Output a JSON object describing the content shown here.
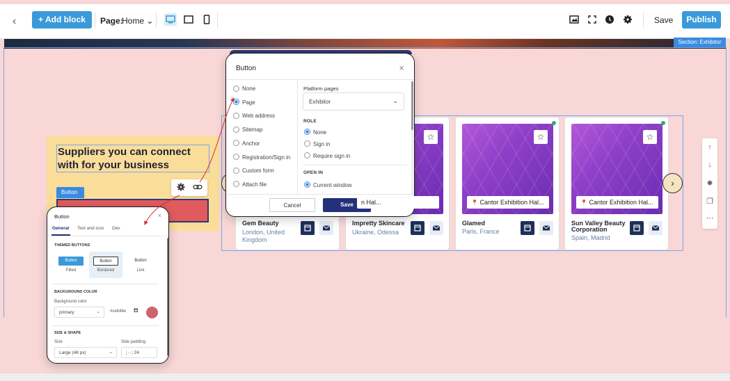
{
  "toolbar": {
    "back": "‹",
    "add_block": "+ Add block",
    "page_label": "Page:",
    "page_value": "Home ⌄",
    "save": "Save",
    "publish": "Publish"
  },
  "canvas": {
    "section_tag": "Section: Exhibitor",
    "heading": "Suppliers you can connect with for your business",
    "button_tag": "Button"
  },
  "cards": [
    {
      "name": "Gem Beauty",
      "sub": "London, United Kingdom",
      "location": ""
    },
    {
      "name": "Impretty Skincare",
      "sub": "Ukraine, Odessa",
      "location": "n Hal..."
    },
    {
      "name": "Glamed",
      "sub": "Paris, France",
      "location": "Cantor Exhibition Hal..."
    },
    {
      "name": "Sun Valley Beauty Corporation",
      "sub": "Spain, Madrid",
      "location": "Cantor Exhibition Hal..."
    }
  ],
  "modal": {
    "title": "Button",
    "close": "×",
    "link_options": [
      "None",
      "Page",
      "Web address",
      "Sitemap",
      "Anchor",
      "Registration/Sign in",
      "Custom form",
      "Attach file"
    ],
    "selected_option": "Page",
    "platform_pages_label": "Platform pages",
    "platform_pages_value": "Exhibitor",
    "role_caption": "ROLE",
    "role_options": [
      "None",
      "Sign in",
      "Require sign in"
    ],
    "open_in_caption": "OPEN IN",
    "open_in_value": "Current window",
    "cancel": "Cancel",
    "save": "Save"
  },
  "panel": {
    "title": "Button",
    "close": "×",
    "tabs": [
      "General",
      "Text and icon",
      "Dev"
    ],
    "themed_caption": "THEMED BUTTONS",
    "button_styles": [
      {
        "preview": "Button",
        "label": "Filled"
      },
      {
        "preview": "Button",
        "label": "Bordered"
      },
      {
        "preview": "Button",
        "label": "Link"
      }
    ],
    "bg_caption": "BACKGROUND COLOR",
    "bg_label": "Background color",
    "bg_select": "primary",
    "bg_hex": "#ce646e",
    "size_caption": "SIZE & SHAPE",
    "size_label": "Size",
    "size_value": "Large (48 px)",
    "padding_label": "Side padding",
    "padding_value": "24",
    "padding_prefix": "|↔|"
  },
  "colors": {
    "accent": "#3a9ad9",
    "navy": "#24307a",
    "button_fill": "#ce646e",
    "canvas_bg": "#f8d7d6",
    "yellow_block": "#fbdd9a"
  }
}
